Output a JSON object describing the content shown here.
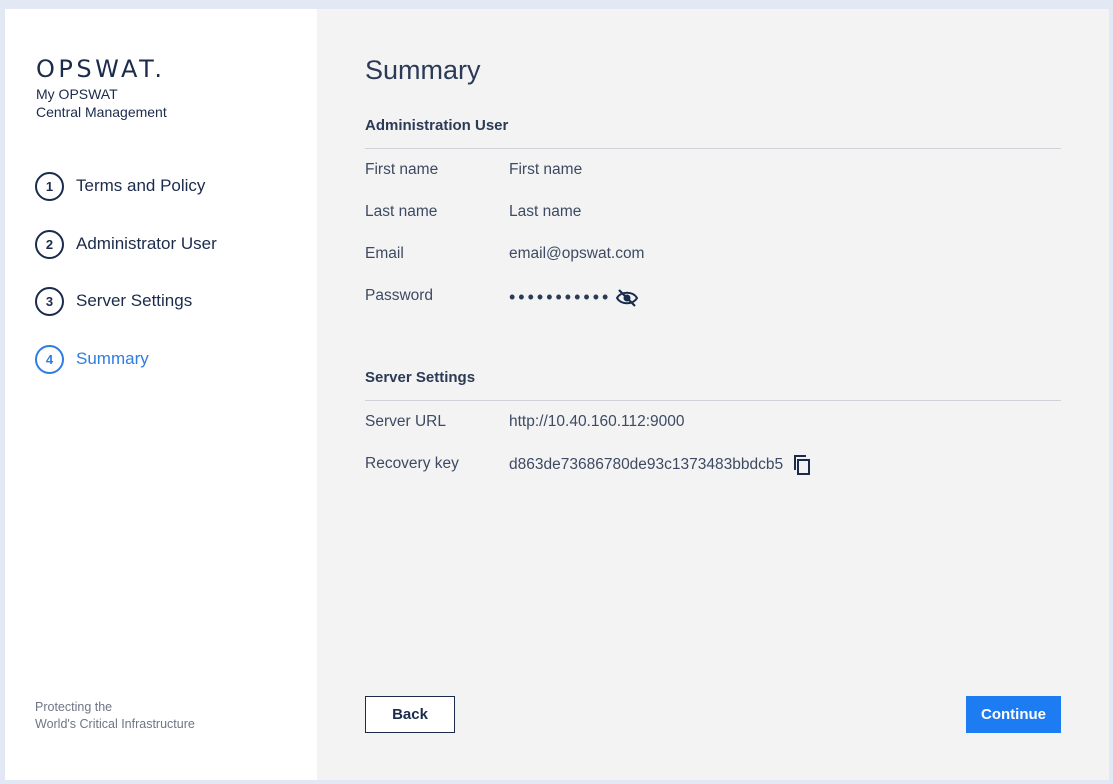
{
  "brand": {
    "logo": "OPSWAT.",
    "product_line1": "My OPSWAT",
    "product_line2": "Central Management",
    "tagline_line1": "Protecting the",
    "tagline_line2": "World's Critical Infrastructure"
  },
  "steps": [
    {
      "num": "1",
      "label": "Terms and Policy",
      "active": false
    },
    {
      "num": "2",
      "label": "Administrator User",
      "active": false
    },
    {
      "num": "3",
      "label": "Server Settings",
      "active": false
    },
    {
      "num": "4",
      "label": "Summary",
      "active": true
    }
  ],
  "summary": {
    "title": "Summary",
    "admin_section": "Administration User",
    "admin_fields": [
      {
        "key": "First name",
        "value": "First name"
      },
      {
        "key": "Last name",
        "value": "Last name"
      },
      {
        "key": "Email",
        "value": "email@opswat.com"
      },
      {
        "key": "Password",
        "value": "•••••••••••"
      }
    ],
    "server_section": "Server Settings",
    "server_fields": [
      {
        "key": "Server URL",
        "value": "http://10.40.160.112:9000"
      },
      {
        "key": "Recovery key",
        "value": "d863de73686780de93c1373483bbdcb5"
      }
    ]
  },
  "actions": {
    "back": "Back",
    "continue": "Continue"
  },
  "colors": {
    "accent": "#2f7de1",
    "primary_button": "#1d7cf2",
    "text": "#1b2b4b",
    "panel": "#f3f3f4"
  },
  "icons": {
    "password_toggle": "eye-off-icon",
    "copy": "copy-icon"
  }
}
